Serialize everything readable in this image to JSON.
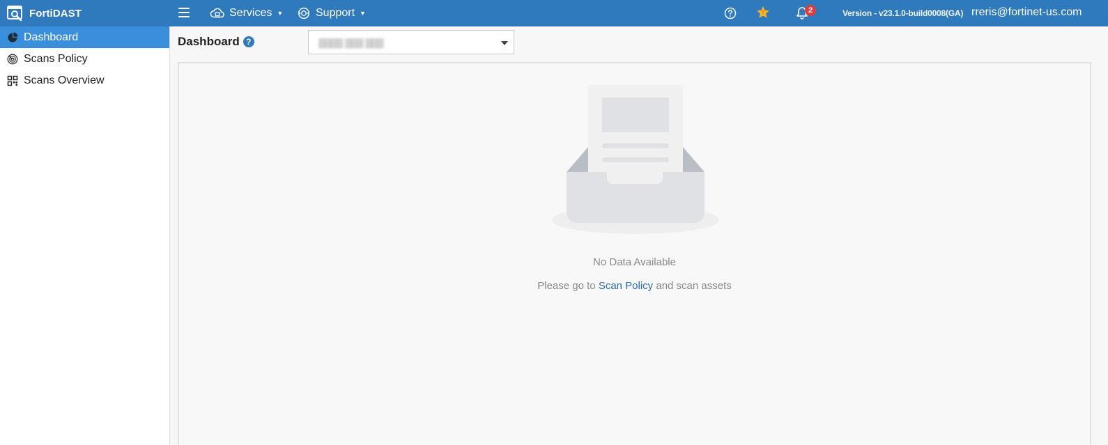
{
  "app": {
    "name": "FortiDAST"
  },
  "topbar": {
    "services_label": "Services",
    "support_label": "Support",
    "notification_count": "2",
    "version": "Version - v23.1.0-build0008(GA)",
    "user_email": "rreris@fortinet-us.com",
    "icons": [
      "menu-icon",
      "cloud-services-icon",
      "support-icon",
      "help-icon",
      "star-icon",
      "bell-icon"
    ],
    "colors": {
      "bar": "#2f79bd",
      "badge": "#e23b3b",
      "star": "#f5b32b"
    }
  },
  "sidebar": {
    "items": [
      {
        "label": "Dashboard",
        "icon": "pie-chart-icon",
        "active": true
      },
      {
        "label": "Scans Policy",
        "icon": "radar-icon",
        "active": false
      },
      {
        "label": "Scans Overview",
        "icon": "grid-icon",
        "active": false
      }
    ],
    "active_color": "#3a8fdc"
  },
  "main": {
    "title": "Dashboard",
    "help_glyph": "?",
    "org_select_value": "▒▒▒▒ ▒▒▒ ▒▒▒"
  },
  "empty_state": {
    "title": "No Data Available",
    "prefix": "Please go to",
    "link": "Scan Policy",
    "suffix": "and scan assets"
  }
}
